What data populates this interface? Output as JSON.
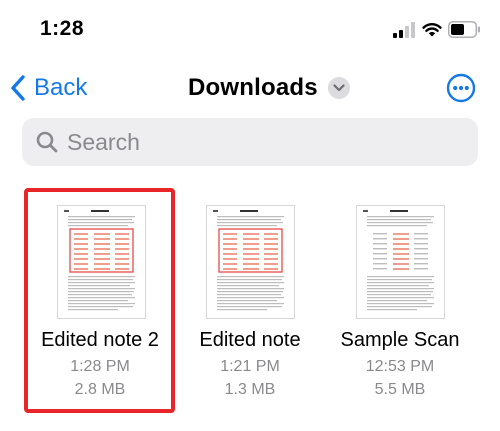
{
  "status_bar": {
    "time": "1:28"
  },
  "nav": {
    "back_label": "Back",
    "title": "Downloads"
  },
  "search": {
    "placeholder": "Search",
    "value": ""
  },
  "files": [
    {
      "name": "Edited note 2",
      "time": "1:28 PM",
      "size": "2.8 MB",
      "selected": true
    },
    {
      "name": "Edited note",
      "time": "1:21 PM",
      "size": "1.3 MB",
      "selected": false
    },
    {
      "name": "Sample Scan",
      "time": "12:53 PM",
      "size": "5.5 MB",
      "selected": false
    }
  ],
  "colors": {
    "accent": "#1479e6",
    "selection": "#e8262a",
    "secondary_text": "#8a8a8e",
    "search_bg": "#eeeef0"
  },
  "icons": [
    "cellular-signal-icon",
    "wifi-icon",
    "battery-icon",
    "chevron-left-icon",
    "chevron-down-icon",
    "more-options-icon",
    "search-icon"
  ]
}
